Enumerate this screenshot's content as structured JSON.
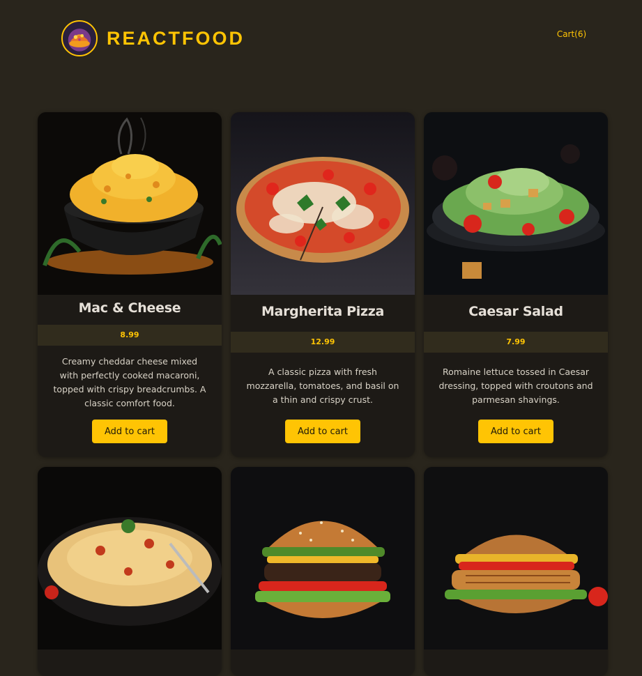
{
  "header": {
    "title": "REACTFOOD",
    "cart_label": "Cart(6)"
  },
  "meals": [
    {
      "name": "Mac & Cheese",
      "price": "8.99",
      "description": "Creamy cheddar cheese mixed with perfectly cooked macaroni, topped with crispy breadcrumbs. A classic comfort food.",
      "button_label": "Add to cart"
    },
    {
      "name": "Margherita Pizza",
      "price": "12.99",
      "description": "A classic pizza with fresh mozzarella, tomatoes, and basil on a thin and crispy crust.",
      "button_label": "Add to cart"
    },
    {
      "name": "Caesar Salad",
      "price": "7.99",
      "description": "Romaine lettuce tossed in Caesar dressing, topped with croutons and parmesan shavings.",
      "button_label": "Add to cart"
    },
    {
      "image": "spaghetti"
    },
    {
      "image": "burger"
    },
    {
      "image": "chicken-burger"
    }
  ],
  "colors": {
    "accent": "#ffc404",
    "background": "#29251c",
    "card": "#1d1a16",
    "price_band": "#312c1d"
  }
}
